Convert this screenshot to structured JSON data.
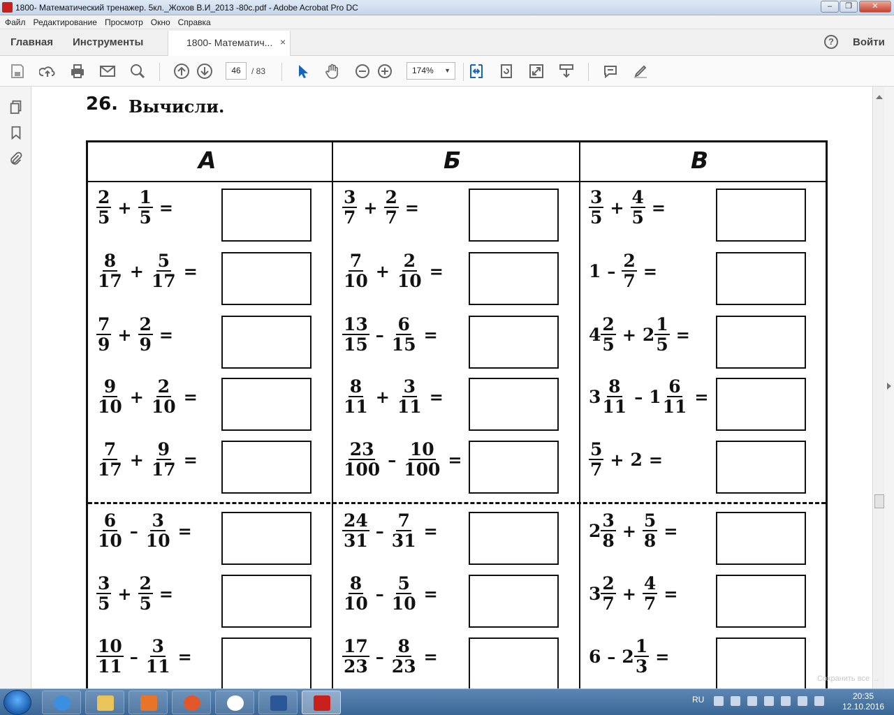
{
  "window": {
    "title": "1800- Математический тренажер. 5кл._Жохов В.И_2013 -80с.pdf - Adobe Acrobat Pro DC"
  },
  "menu": [
    "Файл",
    "Редактирование",
    "Просмотр",
    "Окно",
    "Справка"
  ],
  "tabs": {
    "home": "Главная",
    "tools": "Инструменты",
    "doc": "1800- Математич...",
    "close": "×",
    "help": "?",
    "signin": "Войти"
  },
  "toolbar": {
    "page_current": "46",
    "page_total": "/  83",
    "zoom": "174%"
  },
  "doc": {
    "exercise_number": "26.",
    "exercise_label": "Вычисли.",
    "columns": [
      {
        "header": "А",
        "rows": [
          [
            {
              "n": "2",
              "d": "5"
            },
            "+",
            {
              "n": "1",
              "d": "5"
            },
            "="
          ],
          [
            {
              "n": "8",
              "d": "17"
            },
            "+",
            {
              "n": "5",
              "d": "17"
            },
            "="
          ],
          [
            {
              "n": "7",
              "d": "9"
            },
            "+",
            {
              "n": "2",
              "d": "9"
            },
            "="
          ],
          [
            {
              "n": "9",
              "d": "10"
            },
            "+",
            {
              "n": "2",
              "d": "10"
            },
            "="
          ],
          [
            {
              "n": "7",
              "d": "17"
            },
            "+",
            {
              "n": "9",
              "d": "17"
            },
            "="
          ],
          [
            {
              "n": "6",
              "d": "10"
            },
            "–",
            {
              "n": "3",
              "d": "10"
            },
            "="
          ],
          [
            {
              "n": "3",
              "d": "5"
            },
            "+",
            {
              "n": "2",
              "d": "5"
            },
            "="
          ],
          [
            {
              "n": "10",
              "d": "11"
            },
            "–",
            {
              "n": "3",
              "d": "11"
            },
            "="
          ]
        ]
      },
      {
        "header": "Б",
        "rows": [
          [
            {
              "n": "3",
              "d": "7"
            },
            "+",
            {
              "n": "2",
              "d": "7"
            },
            "="
          ],
          [
            {
              "n": "7",
              "d": "10"
            },
            "+",
            {
              "n": "2",
              "d": "10"
            },
            "="
          ],
          [
            {
              "n": "13",
              "d": "15"
            },
            "–",
            {
              "n": "6",
              "d": "15"
            },
            "="
          ],
          [
            {
              "n": "8",
              "d": "11"
            },
            "+",
            {
              "n": "3",
              "d": "11"
            },
            "="
          ],
          [
            {
              "n": "23",
              "d": "100"
            },
            "–",
            {
              "n": "10",
              "d": "100"
            },
            "="
          ],
          [
            {
              "n": "24",
              "d": "31"
            },
            "–",
            {
              "n": "7",
              "d": "31"
            },
            "="
          ],
          [
            {
              "n": "8",
              "d": "10"
            },
            "–",
            {
              "n": "5",
              "d": "10"
            },
            "="
          ],
          [
            {
              "n": "17",
              "d": "23"
            },
            "–",
            {
              "n": "8",
              "d": "23"
            },
            "="
          ]
        ]
      },
      {
        "header": "В",
        "rows": [
          [
            {
              "n": "3",
              "d": "5"
            },
            "+",
            {
              "n": "4",
              "d": "5"
            },
            "="
          ],
          [
            "1",
            "–",
            {
              "n": "2",
              "d": "7"
            },
            "="
          ],
          [
            {
              "w": "4",
              "n": "2",
              "d": "5"
            },
            "+",
            {
              "w": "2",
              "n": "1",
              "d": "5"
            },
            "="
          ],
          [
            {
              "w": "3",
              "n": "8",
              "d": "11"
            },
            "–",
            {
              "w": "1",
              "n": "6",
              "d": "11"
            },
            "="
          ],
          [
            {
              "n": "5",
              "d": "7"
            },
            "+",
            "2",
            "="
          ],
          [
            {
              "w": "2",
              "n": "3",
              "d": "8"
            },
            "+",
            {
              "n": "5",
              "d": "8"
            },
            "="
          ],
          [
            {
              "w": "3",
              "n": "2",
              "d": "7"
            },
            "+",
            {
              "n": "4",
              "d": "7"
            },
            "="
          ],
          [
            "6",
            "–",
            {
              "w": "2",
              "n": "1",
              "d": "3"
            },
            "="
          ]
        ]
      }
    ]
  },
  "taskbar": {
    "lang": "RU",
    "time": "20:35",
    "date": "12.10.2016",
    "watermark": "Сохранить все ..."
  }
}
